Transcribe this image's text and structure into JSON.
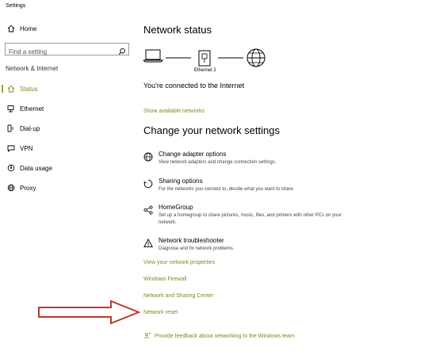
{
  "window": {
    "title": "Settings"
  },
  "sidebar": {
    "home_label": "Home",
    "search_placeholder": "Find a setting",
    "section_label": "Network & Internet",
    "items": [
      {
        "label": "Status",
        "icon": "home-status-icon",
        "active": true
      },
      {
        "label": "Ethernet",
        "icon": "ethernet-icon"
      },
      {
        "label": "Dial-up",
        "icon": "phone-icon"
      },
      {
        "label": "VPN",
        "icon": "vpn-icon"
      },
      {
        "label": "Data usage",
        "icon": "data-usage-icon"
      },
      {
        "label": "Proxy",
        "icon": "globe-icon"
      }
    ]
  },
  "main": {
    "network_status_title": "Network status",
    "adapter_caption": "Ethernet 2",
    "connected_text": "You're connected to the Internet",
    "show_networks_link": "Show available networks",
    "change_title": "Change your network settings",
    "options": [
      {
        "title": "Change adapter options",
        "desc": "View network adapters and change connection settings.",
        "icon": "adapter-options-icon"
      },
      {
        "title": "Sharing options",
        "desc": "For the networks you connect to, decide what you want to share.",
        "icon": "sharing-options-icon"
      },
      {
        "title": "HomeGroup",
        "desc": "Set up a homegroup to share pictures, music, files, and printers with other PCs on your network.",
        "icon": "homegroup-icon"
      },
      {
        "title": "Network troubleshooter",
        "desc": "Diagnose and fix network problems.",
        "icon": "warning-icon"
      }
    ],
    "links": {
      "properties": "View your network properties",
      "firewall": "Windows Firewall",
      "sharing_center": "Network and Sharing Center",
      "reset": "Network reset",
      "feedback": "Provide feedback about networking to the Windows team"
    }
  },
  "colors": {
    "accent": "#9aa62a",
    "link": "#7a8b1f",
    "annotation_arrow": "#c0392b"
  }
}
